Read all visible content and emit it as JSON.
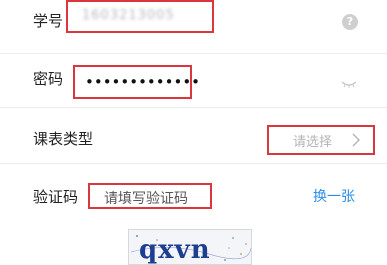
{
  "form": {
    "student_id": {
      "label": "学号",
      "value": "1603213005"
    },
    "password": {
      "label": "密码",
      "value": "•••••••••••••"
    },
    "schedule_type": {
      "label": "课表类型",
      "placeholder": "请选择"
    },
    "captcha": {
      "label": "验证码",
      "placeholder": "请填写验证码",
      "refresh_label": "换一张",
      "image_text": "qxvn"
    }
  },
  "colors": {
    "highlight_border": "#d9363e",
    "link": "#2a8ee6",
    "captcha_text": "#1d3f8f"
  },
  "icons": {
    "help": "question-circle-icon",
    "visibility": "eye-closed-icon",
    "chevron": "chevron-right-icon"
  }
}
